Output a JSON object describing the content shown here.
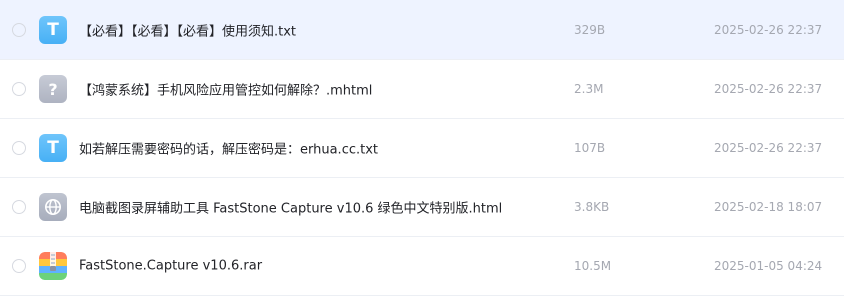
{
  "files": [
    {
      "name": "【必看】【必看】【必看】使用须知.txt",
      "size": "329B",
      "date": "2025-02-26 22:37",
      "icon": "txt-file-icon",
      "icon_glyph": "T",
      "selected": true
    },
    {
      "name": "【鸿蒙系统】手机风险应用管控如何解除？.mhtml",
      "size": "2.3M",
      "date": "2025-02-26 22:37",
      "icon": "unknown-file-icon",
      "icon_glyph": "?",
      "selected": false
    },
    {
      "name": "如若解压需要密码的话，解压密码是：erhua.cc.txt",
      "size": "107B",
      "date": "2025-02-26 22:37",
      "icon": "txt-file-icon",
      "icon_glyph": "T",
      "selected": false
    },
    {
      "name": "电脑截图录屏辅助工具 FastStone Capture v10.6 绿色中文特别版.html",
      "size": "3.8KB",
      "date": "2025-02-18 18:07",
      "icon": "globe-file-icon",
      "selected": false
    },
    {
      "name": "FastStone.Capture v10.6.rar",
      "size": "10.5M",
      "date": "2025-01-05 04:24",
      "icon": "archive-file-icon",
      "selected": false
    }
  ],
  "colors": {
    "selected_row_bg": "#eef3ff",
    "txt_icon": "#47b0f5",
    "unknown_icon": "#aeb3c1",
    "meta_text": "#a5a8b1"
  }
}
